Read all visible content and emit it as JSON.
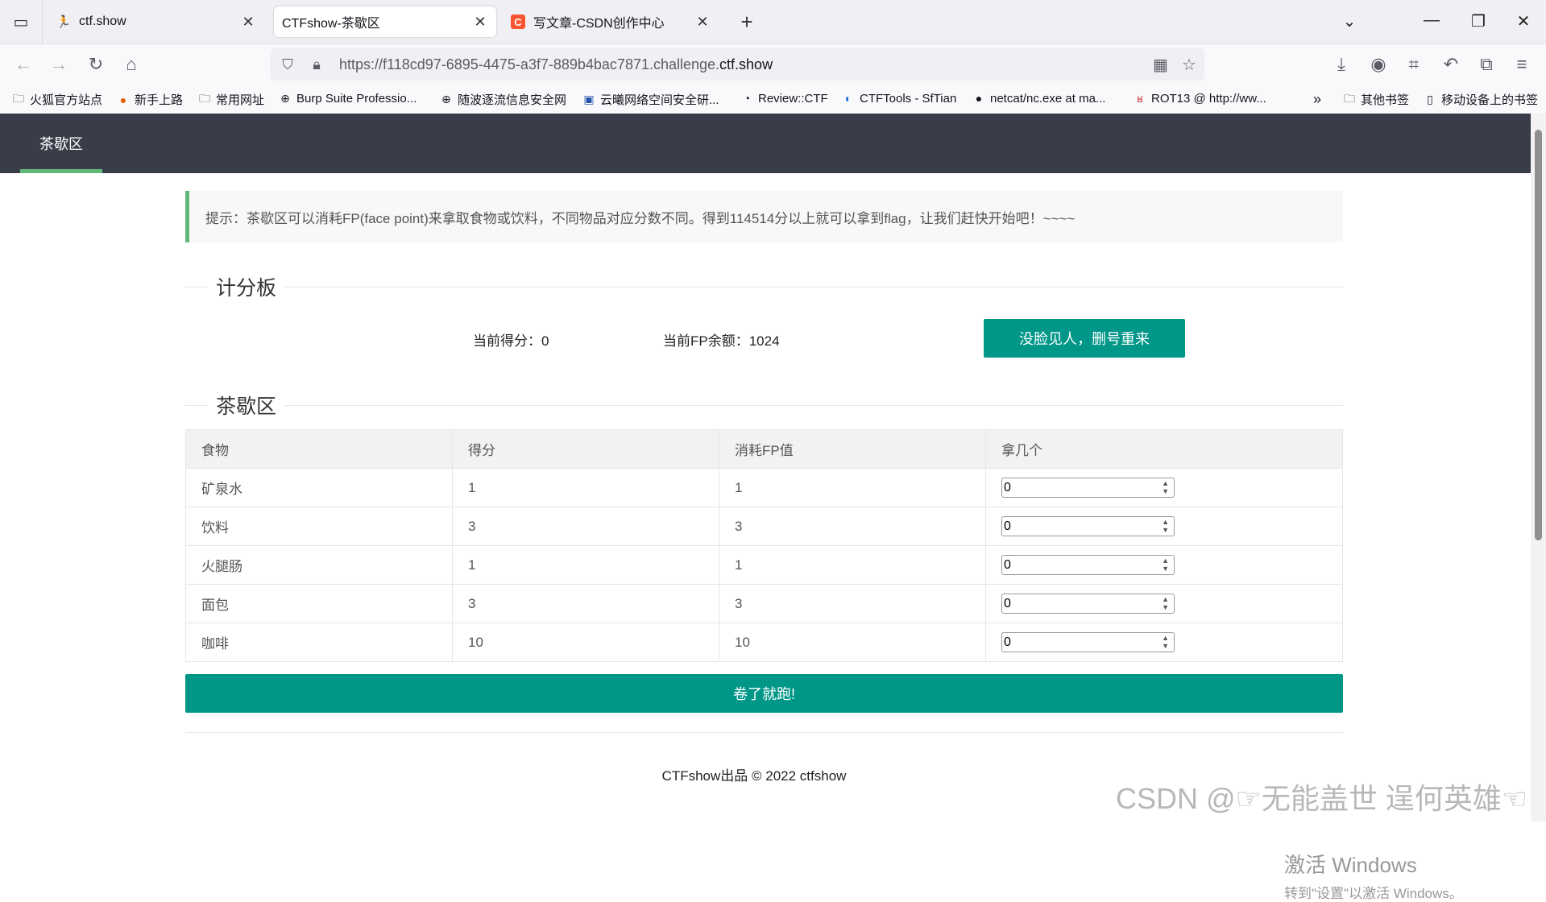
{
  "browser": {
    "tabs": [
      {
        "title": "ctf.show",
        "active": false
      },
      {
        "title": "CTFshow-茶歇区",
        "active": true
      },
      {
        "title": "写文章-CSDN创作中心",
        "active": false
      }
    ],
    "csdn_fav": "C",
    "url_prefix": "https://f118cd97-6895-4475-a3f7-889b4bac7871.challenge.",
    "url_domain": "ctf.show",
    "bookmarks": [
      "火狐官方站点",
      "新手上路",
      "常用网址",
      "Burp Suite Professio...",
      "随波逐流信息安全网",
      "云曦网络空间安全研...",
      "Review::CTF",
      "CTFTools - SfTian",
      "netcat/nc.exe at ma...",
      "ROT13 @ http://ww..."
    ],
    "bookmarks_right": [
      "其他书签",
      "移动设备上的书签"
    ]
  },
  "site": {
    "nav_item": "茶歇区",
    "notice": "提示：茶歇区可以消耗FP(face point)来拿取食物或饮料，不同物品对应分数不同。得到114514分以上就可以拿到flag，让我们赶快开始吧！~~~~",
    "scoreboard_legend": "计分板",
    "score_label": "当前得分：0",
    "fp_label": "当前FP余额：1024",
    "reset_button": "没脸见人，删号重来",
    "break_legend": "茶歇区",
    "table": {
      "headers": [
        "食物",
        "得分",
        "消耗FP值",
        "拿几个"
      ],
      "rows": [
        {
          "name": "矿泉水",
          "score": "1",
          "fp": "1",
          "qty": "0"
        },
        {
          "name": "饮料",
          "score": "3",
          "fp": "3",
          "qty": "0"
        },
        {
          "name": "火腿肠",
          "score": "1",
          "fp": "1",
          "qty": "0"
        },
        {
          "name": "面包",
          "score": "3",
          "fp": "3",
          "qty": "0"
        },
        {
          "name": "咖啡",
          "score": "10",
          "fp": "10",
          "qty": "0"
        }
      ]
    },
    "submit_button": "卷了就跑!",
    "footer": "CTFshow出品 © 2022 ctfshow"
  },
  "overlay": {
    "activate_title": "激活 Windows",
    "activate_sub": "转到\"设置\"以激活 Windows。",
    "watermark": "CSDN @☞无能盖世 逞何英雄☜"
  },
  "colors": {
    "nav_bg": "#393d49",
    "accent_green": "#5fb878",
    "button_teal": "#009688"
  }
}
